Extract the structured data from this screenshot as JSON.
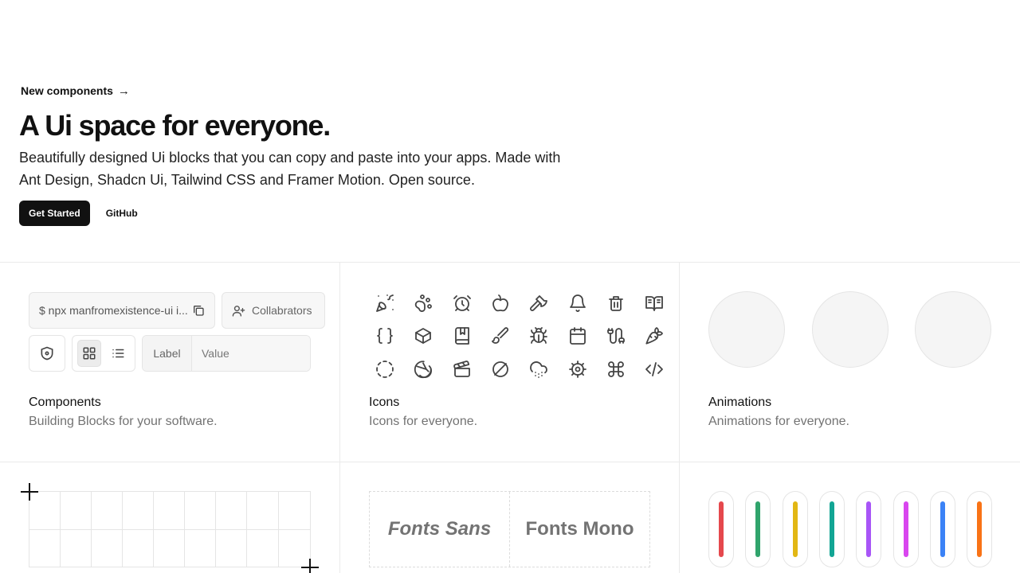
{
  "hero": {
    "link_label": "New components",
    "title": "A Ui space for everyone.",
    "description": "Beautifully designed Ui blocks that you can copy and paste into your apps. Made with Ant Design, Shadcn Ui, Tailwind CSS and Framer Motion. Open source.",
    "primary_button": "Get Started",
    "secondary_button": "GitHub"
  },
  "components_card": {
    "command": "$ npx manfromexistence-ui i...",
    "collab_label": "Collabrators",
    "field_label": "Label",
    "field_value": "Value",
    "title": "Components",
    "subtitle": "Building Blocks for your software."
  },
  "icons_card": {
    "icons": [
      "party-popper-icon",
      "paw-icon",
      "alarm-clock-icon",
      "apple-icon",
      "axe-icon",
      "bell-icon",
      "trash-bin-icon",
      "book-open-icon",
      "braces-icon",
      "box-icon",
      "bookmark-book-icon",
      "brush-icon",
      "bug-icon",
      "calendar-icon",
      "cable-icon",
      "carrot-icon",
      "circle-dashed-icon",
      "citrus-icon",
      "clapperboard-icon",
      "circle-slash-icon",
      "cloud-rain-icon",
      "cog-icon",
      "command-icon",
      "code-icon"
    ],
    "title": "Icons",
    "subtitle": "Icons for everyone."
  },
  "animations_card": {
    "title": "Animations",
    "subtitle": "Animations for everyone."
  },
  "fonts_card": {
    "sans_label": "Fonts Sans",
    "mono_label": "Fonts Mono"
  },
  "colors_card": {
    "bars": [
      "#e5484d",
      "#30a46c",
      "#e2b714",
      "#12a594",
      "#a855f7",
      "#d946ef",
      "#3b82f6",
      "#f97316"
    ]
  }
}
